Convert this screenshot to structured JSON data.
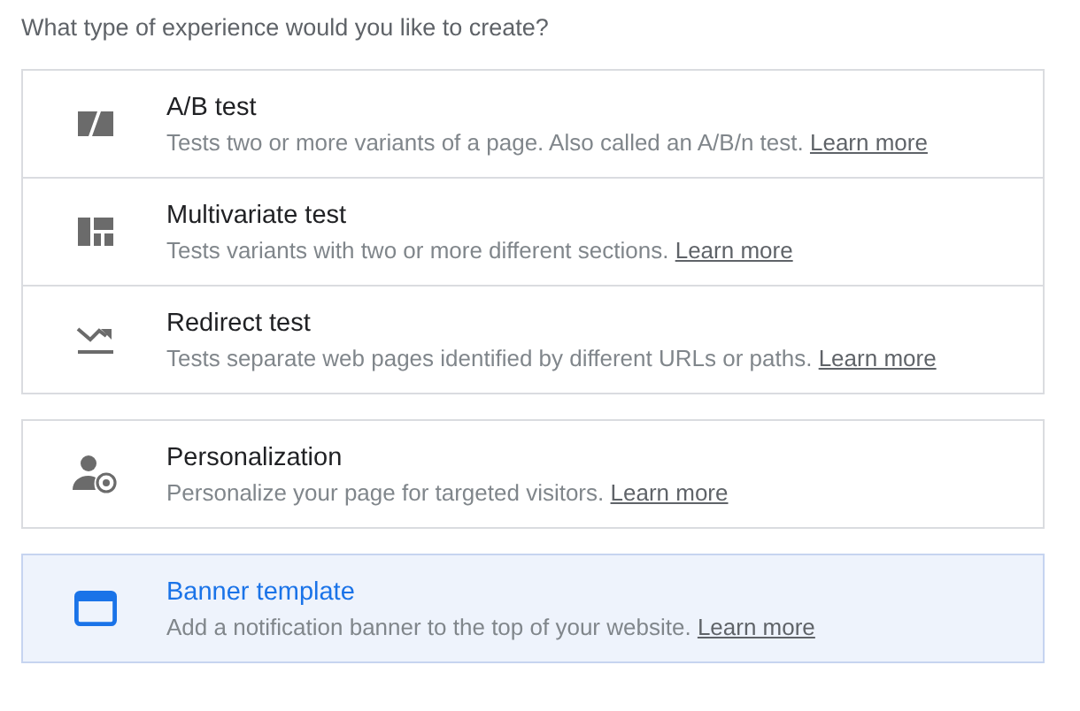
{
  "question": "What type of experience would you like to create?",
  "groups": [
    {
      "options": [
        {
          "kind": "ab",
          "title": "A/B test",
          "description": "Tests two or more variants of a page. Also called an A/B/n test.",
          "link": "Learn more",
          "selected": false
        },
        {
          "kind": "multivariate",
          "title": "Multivariate test",
          "description": "Tests variants with two or more different sections.",
          "link": "Learn more",
          "selected": false
        },
        {
          "kind": "redirect",
          "title": "Redirect test",
          "description": "Tests separate web pages identified by different URLs or paths.",
          "link": "Learn more",
          "selected": false
        }
      ]
    },
    {
      "options": [
        {
          "kind": "personalization",
          "title": "Personalization",
          "description": "Personalize your page for targeted visitors.",
          "link": "Learn more",
          "selected": false
        }
      ]
    },
    {
      "options": [
        {
          "kind": "banner",
          "title": "Banner template",
          "description": "Add a notification banner to the top of your website.",
          "link": "Learn more",
          "selected": true
        }
      ]
    }
  ]
}
